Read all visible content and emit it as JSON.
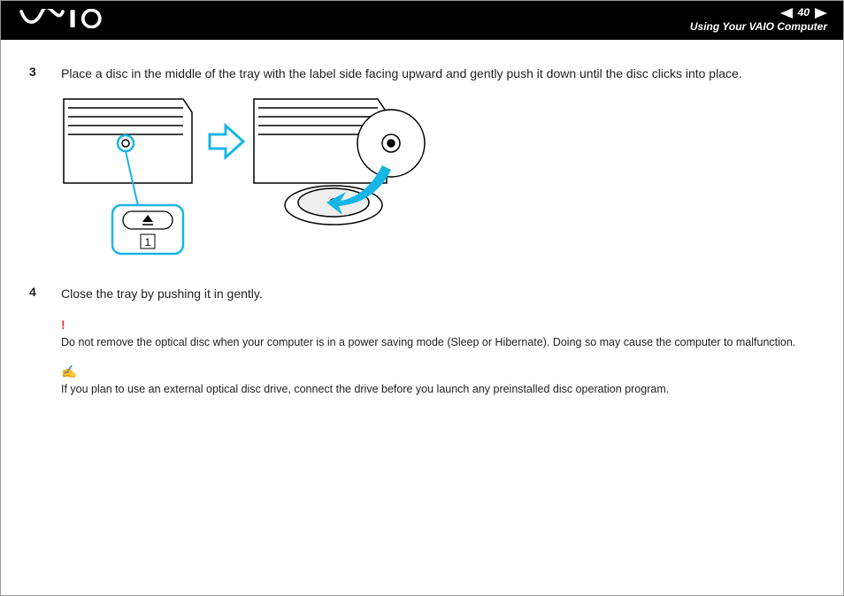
{
  "header": {
    "page_number": "40",
    "section": "Using Your VAIO Computer"
  },
  "steps": [
    {
      "num": "3",
      "text": "Place a disc in the middle of the tray with the label side facing upward and gently push it down until the disc clicks into place."
    },
    {
      "num": "4",
      "text": "Close the tray by pushing it in gently."
    }
  ],
  "warning": {
    "mark": "!",
    "text": "Do not remove the optical disc when your computer is in a power saving mode (Sleep or Hibernate). Doing so may cause the computer to malfunction."
  },
  "note": {
    "mark": "✍",
    "text": "If you plan to use an external optical disc drive, connect the drive before you launch any preinstalled disc operation program."
  },
  "figure": {
    "callout": "1"
  }
}
